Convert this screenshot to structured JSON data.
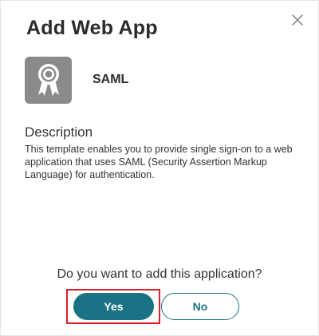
{
  "dialog": {
    "title": "Add Web App",
    "close_icon": "close-icon"
  },
  "app": {
    "icon": "certificate-ribbon-icon",
    "name": "SAML"
  },
  "description": {
    "heading": "Description",
    "body": "This template enables you to provide single sign-on to a web application that uses SAML (Security Assertion Markup Language) for authentication."
  },
  "prompt": {
    "question": "Do you want to add this application?"
  },
  "buttons": {
    "yes_label": "Yes",
    "no_label": "No"
  },
  "colors": {
    "accent": "#1a7384",
    "highlight": "#d81f2a",
    "icon_bg": "#8a8a8a"
  }
}
